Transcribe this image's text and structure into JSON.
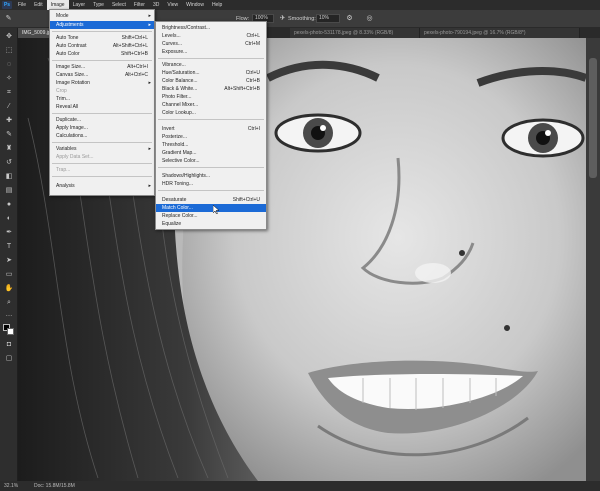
{
  "menubar": {
    "logo": "Ps",
    "items": [
      "File",
      "Edit",
      "Image",
      "Layer",
      "Type",
      "Select",
      "Filter",
      "3D",
      "View",
      "Window",
      "Help"
    ]
  },
  "options": {
    "flow_label": "Flow:",
    "flow_value": "100%",
    "smoothing_label": "Smoothing:",
    "smoothing_value": "10%"
  },
  "tabs": [
    {
      "label": "IMG_5009.jpg @ 32.1% (RGB/8)"
    },
    {
      "label": "pexels-photo-531178.jpeg @ 8.33% (RGB/8)"
    },
    {
      "label": "pexels-photo-790194.jpeg @ 16.7% (RGB/8*)"
    }
  ],
  "image_menu": {
    "items": [
      {
        "label": "Mode",
        "shortcut": "",
        "submenu": true,
        "state": "normal"
      },
      {
        "label": "Adjustments",
        "shortcut": "",
        "submenu": true,
        "state": "highlighted"
      },
      {
        "label": "Auto Tone",
        "shortcut": "Shift+Ctrl+L",
        "state": "normal"
      },
      {
        "label": "Auto Contrast",
        "shortcut": "Alt+Shift+Ctrl+L",
        "state": "normal"
      },
      {
        "label": "Auto Color",
        "shortcut": "Shift+Ctrl+B",
        "state": "normal"
      },
      {
        "label": "Image Size...",
        "shortcut": "Alt+Ctrl+I",
        "state": "normal"
      },
      {
        "label": "Canvas Size...",
        "shortcut": "Alt+Ctrl+C",
        "state": "normal"
      },
      {
        "label": "Image Rotation",
        "shortcut": "",
        "submenu": true,
        "state": "normal"
      },
      {
        "label": "Crop",
        "shortcut": "",
        "state": "disabled"
      },
      {
        "label": "Trim...",
        "shortcut": "",
        "state": "normal"
      },
      {
        "label": "Reveal All",
        "shortcut": "",
        "state": "normal"
      },
      {
        "label": "Duplicate...",
        "shortcut": "",
        "state": "normal"
      },
      {
        "label": "Apply Image...",
        "shortcut": "",
        "state": "normal"
      },
      {
        "label": "Calculations...",
        "shortcut": "",
        "state": "normal"
      },
      {
        "label": "Variables",
        "shortcut": "",
        "submenu": true,
        "state": "normal"
      },
      {
        "label": "Apply Data Set...",
        "shortcut": "",
        "state": "disabled"
      },
      {
        "label": "Trap...",
        "shortcut": "",
        "state": "disabled"
      },
      {
        "label": "Analysis",
        "shortcut": "",
        "submenu": true,
        "state": "normal"
      }
    ]
  },
  "adjustments_menu": {
    "items": [
      {
        "label": "Brightness/Contrast...",
        "shortcut": "",
        "state": "normal"
      },
      {
        "label": "Levels...",
        "shortcut": "Ctrl+L",
        "state": "normal"
      },
      {
        "label": "Curves...",
        "shortcut": "Ctrl+M",
        "state": "normal"
      },
      {
        "label": "Exposure...",
        "shortcut": "",
        "state": "normal"
      },
      {
        "label": "Vibrance...",
        "shortcut": "",
        "state": "normal"
      },
      {
        "label": "Hue/Saturation...",
        "shortcut": "Ctrl+U",
        "state": "normal"
      },
      {
        "label": "Color Balance...",
        "shortcut": "Ctrl+B",
        "state": "normal"
      },
      {
        "label": "Black & White...",
        "shortcut": "Alt+Shift+Ctrl+B",
        "state": "normal"
      },
      {
        "label": "Photo Filter...",
        "shortcut": "",
        "state": "normal"
      },
      {
        "label": "Channel Mixer...",
        "shortcut": "",
        "state": "normal"
      },
      {
        "label": "Color Lookup...",
        "shortcut": "",
        "state": "normal"
      },
      {
        "label": "Invert",
        "shortcut": "Ctrl+I",
        "state": "normal"
      },
      {
        "label": "Posterize...",
        "shortcut": "",
        "state": "normal"
      },
      {
        "label": "Threshold...",
        "shortcut": "",
        "state": "normal"
      },
      {
        "label": "Gradient Map...",
        "shortcut": "",
        "state": "normal"
      },
      {
        "label": "Selective Color...",
        "shortcut": "",
        "state": "normal"
      },
      {
        "label": "Shadows/Highlights...",
        "shortcut": "",
        "state": "normal"
      },
      {
        "label": "HDR Toning...",
        "shortcut": "",
        "state": "normal"
      },
      {
        "label": "Desaturate",
        "shortcut": "Shift+Ctrl+U",
        "state": "normal"
      },
      {
        "label": "Match Color...",
        "shortcut": "",
        "state": "highlighted"
      },
      {
        "label": "Replace Color...",
        "shortcut": "",
        "state": "normal"
      },
      {
        "label": "Equalize",
        "shortcut": "",
        "state": "normal"
      }
    ]
  },
  "status": {
    "zoom": "32.1%",
    "doc": "Doc: 15.8M/15.8M"
  },
  "colors": {
    "highlight": "#1b6ad6",
    "menu_bg": "#f0f0f0",
    "ui_dark": "#2c2c2c"
  }
}
